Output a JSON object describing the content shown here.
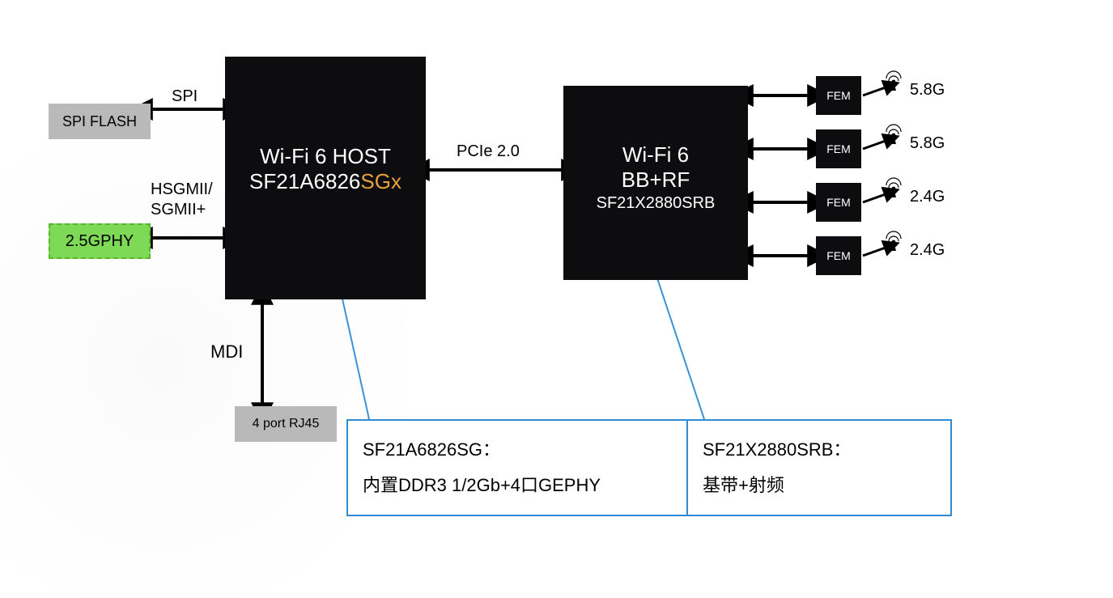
{
  "blocks": {
    "spi_flash": "SPI FLASH",
    "phy25": "2.5GPHY",
    "rj45": "4 port RJ45",
    "host_l1": "Wi-Fi 6 HOST",
    "host_l2a": "SF21A6826",
    "host_l2b": "SGx",
    "bb_l1": "Wi-Fi 6",
    "bb_l2": "BB+RF",
    "bb_l3": "SF21X2880SRB",
    "fem": "FEM"
  },
  "links": {
    "spi": "SPI",
    "hsgmii": "HSGMII/\nSGMII+",
    "pcie": "PCIe 2.0",
    "mdi": "MDI"
  },
  "freq": {
    "g58": "5.8G",
    "g24": "2.4G"
  },
  "callouts": {
    "left_t": "SF21A6826SG：",
    "left_b": "内置DDR3 1/2Gb+4口GEPHY",
    "right_t": "SF21X2880SRB：",
    "right_b": "基带+射频"
  }
}
